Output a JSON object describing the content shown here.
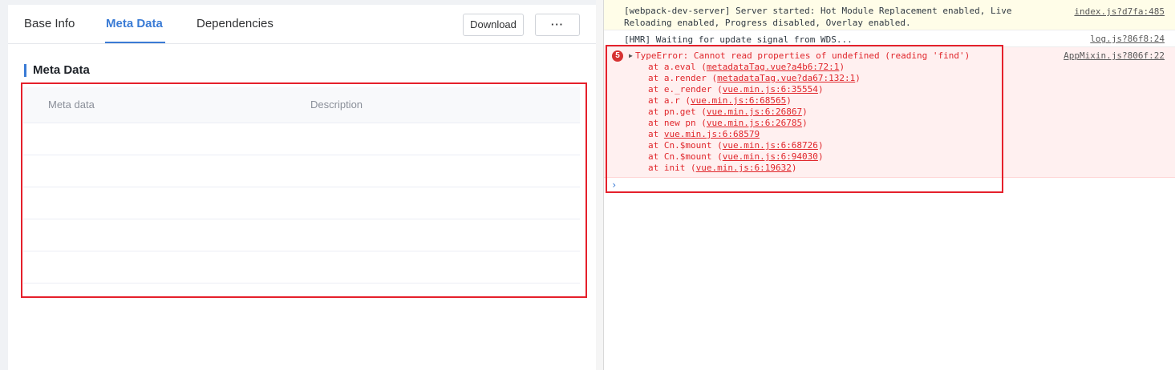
{
  "tabs": [
    {
      "label": "Base Info",
      "active": false
    },
    {
      "label": "Meta Data",
      "active": true
    },
    {
      "label": "Dependencies",
      "active": false
    }
  ],
  "toolbar": {
    "download_label": "Download",
    "more_label": "···"
  },
  "section": {
    "title": "Meta Data"
  },
  "table": {
    "columns": [
      "Meta data",
      "Description"
    ],
    "rows": []
  },
  "console": {
    "messages": [
      {
        "text": "[webpack-dev-server] Server started: Hot Module Replacement enabled, Live Reloading enabled, Progress disabled, Overlay enabled.",
        "source": "index.js?d7fa:485"
      },
      {
        "text": "[HMR] Waiting for update signal from WDS...",
        "source": "log.js?86f8:24"
      }
    ],
    "error": {
      "count": "5",
      "title": "TypeError: Cannot read properties of undefined (reading 'find')",
      "source": "AppMixin.js?806f:22",
      "frames": [
        {
          "prefix": "at a.eval (",
          "link": "metadataTag.vue?a4b6:72:1",
          "suffix": ")"
        },
        {
          "prefix": "at a.render (",
          "link": "metadataTag.vue?da67:132:1",
          "suffix": ")"
        },
        {
          "prefix": "at e._render (",
          "link": "vue.min.js:6:35554",
          "suffix": ")"
        },
        {
          "prefix": "at a.r (",
          "link": "vue.min.js:6:68565",
          "suffix": ")"
        },
        {
          "prefix": "at pn.get (",
          "link": "vue.min.js:6:26867",
          "suffix": ")"
        },
        {
          "prefix": "at new pn (",
          "link": "vue.min.js:6:26785",
          "suffix": ")"
        },
        {
          "prefix": "at ",
          "link": "vue.min.js:6:68579",
          "suffix": ""
        },
        {
          "prefix": "at Cn.$mount (",
          "link": "vue.min.js:6:68726",
          "suffix": ")"
        },
        {
          "prefix": "at Cn.$mount (",
          "link": "vue.min.js:6:94030",
          "suffix": ")"
        },
        {
          "prefix": "at init (",
          "link": "vue.min.js:6:19632",
          "suffix": ")"
        }
      ]
    },
    "prompt_symbol": "›"
  },
  "colors": {
    "accent": "#3a7bd5",
    "error": "#e0262b",
    "highlight": "#e5202b"
  }
}
